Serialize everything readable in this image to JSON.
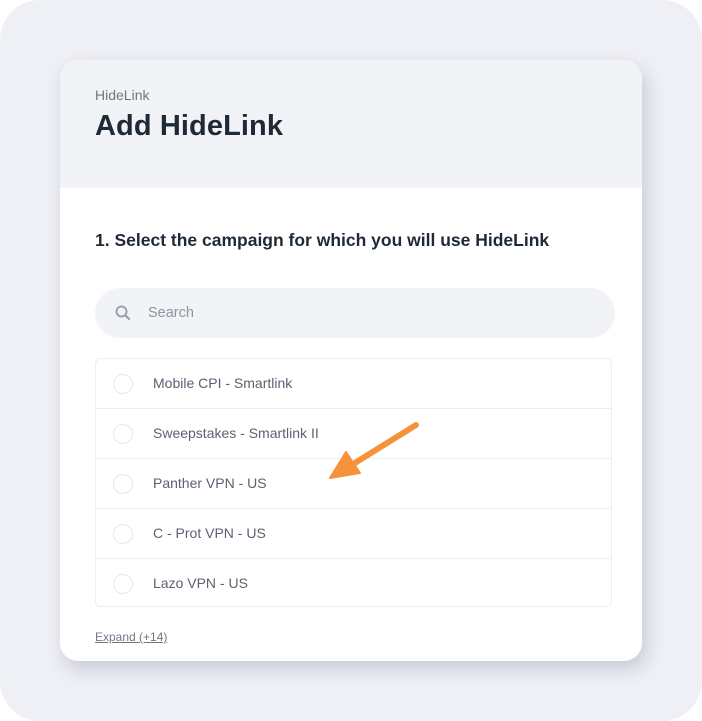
{
  "header": {
    "breadcrumb": "HideLink",
    "title": "Add HideLink"
  },
  "step": {
    "title": "1. Select the campaign for which you will use HideLink"
  },
  "search": {
    "placeholder": "Search",
    "icon": "search-icon"
  },
  "campaigns": [
    {
      "label": "Mobile CPI - Smartlink"
    },
    {
      "label": "Sweepstakes - Smartlink II"
    },
    {
      "label": "Panther VPN - US"
    },
    {
      "label": "C - Prot VPN - US"
    },
    {
      "label": "Lazo VPN - US"
    }
  ],
  "expand": {
    "label": "Expand (+14)"
  },
  "colors": {
    "backdrop": "#eff0f6",
    "header_bg": "#f1f3f7",
    "title": "#1f2a36",
    "arrow": "#f5923b"
  }
}
